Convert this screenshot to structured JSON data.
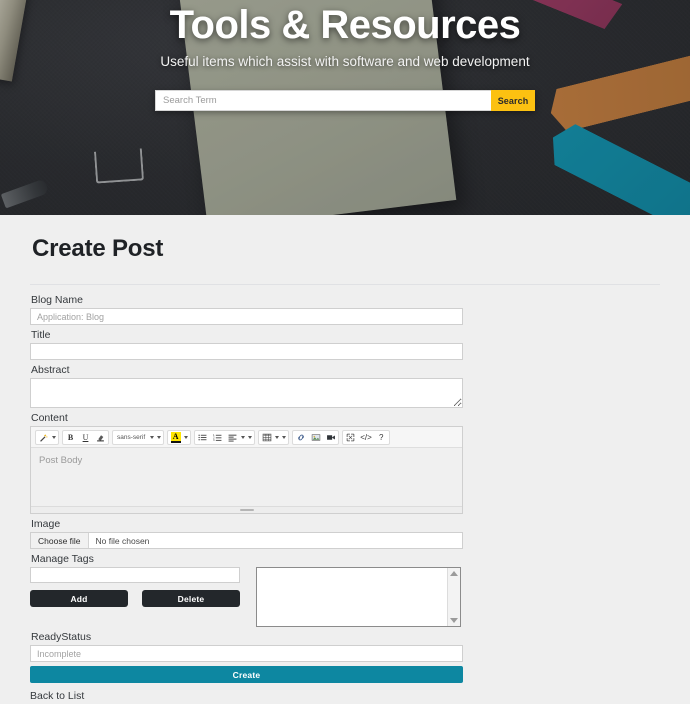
{
  "hero": {
    "title": "Tools & Resources",
    "subtitle": "Useful items which assist with software and web development",
    "search": {
      "placeholder": "Search Term",
      "value": "",
      "button_label": "Search",
      "button_color": "#fcc111"
    },
    "background_colors": {
      "desk": "#2e3033",
      "paper_sheet": "#aeb29f",
      "strip_orange": "#c8803f",
      "strip_teal": "#1295b0",
      "strip_magenta": "#9e3a63"
    }
  },
  "main": {
    "page_title": "Create Post",
    "fields": {
      "blog_name": {
        "label": "Blog Name",
        "placeholder": "Application: Blog",
        "value": ""
      },
      "title": {
        "label": "Title",
        "placeholder": "",
        "value": ""
      },
      "abstract": {
        "label": "Abstract",
        "placeholder": "",
        "value": ""
      },
      "content": {
        "label": "Content",
        "placeholder": "Post Body",
        "value": ""
      },
      "image": {
        "label": "Image",
        "choose_file_label": "Choose file",
        "file_status": "No file chosen"
      },
      "manage_tags": {
        "label": "Manage Tags",
        "input_value": "",
        "input_placeholder": "",
        "add_label": "Add",
        "delete_label": "Delete",
        "list_items": []
      },
      "ready_status": {
        "label": "ReadyStatus",
        "placeholder": "Incomplete",
        "value": ""
      }
    },
    "submit": {
      "label": "Create",
      "color": "#0d87a1"
    },
    "back_link": "Back to List"
  },
  "editor_toolbar": {
    "groups": [
      {
        "items": [
          {
            "icon": "magic-wand-icon",
            "glyph": "✦",
            "has_caret": true
          }
        ]
      },
      {
        "items": [
          {
            "icon": "bold-icon",
            "glyph": "B"
          },
          {
            "icon": "underline-icon",
            "glyph": "U"
          },
          {
            "icon": "remove-format-icon",
            "glyph": "✐"
          }
        ]
      },
      {
        "items": [
          {
            "icon": "font-family-select",
            "glyph": "sans-serif",
            "has_caret": true,
            "has_second_caret": true
          }
        ]
      },
      {
        "items": [
          {
            "icon": "text-highlight-color-icon",
            "glyph": "A",
            "has_caret": true
          }
        ]
      },
      {
        "items": [
          {
            "icon": "unordered-list-icon",
            "glyph": "≡"
          },
          {
            "icon": "ordered-list-icon",
            "glyph": "≣"
          },
          {
            "icon": "paragraph-align-icon",
            "glyph": "≡",
            "has_caret": true,
            "has_second_caret": true
          }
        ]
      },
      {
        "items": [
          {
            "icon": "table-icon",
            "glyph": "▦",
            "has_caret": true,
            "has_second_caret": true
          }
        ]
      },
      {
        "items": [
          {
            "icon": "link-icon",
            "glyph": "⚭"
          },
          {
            "icon": "picture-icon",
            "glyph": "ὛB"
          },
          {
            "icon": "video-icon",
            "glyph": "▣"
          }
        ]
      },
      {
        "items": [
          {
            "icon": "fullscreen-icon",
            "glyph": "⤢"
          },
          {
            "icon": "code-view-icon",
            "glyph": "</>"
          },
          {
            "icon": "help-icon",
            "glyph": "?"
          }
        ]
      }
    ]
  }
}
